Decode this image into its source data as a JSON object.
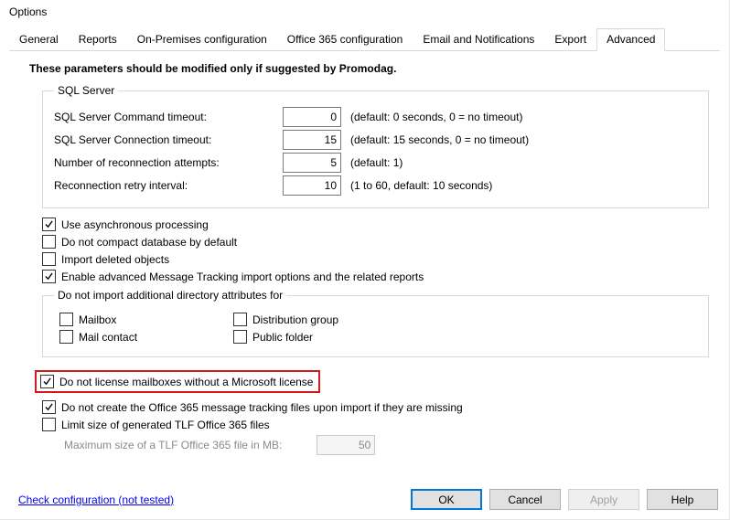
{
  "window_title": "Options",
  "tabs": {
    "general": "General",
    "reports": "Reports",
    "onprem": "On-Premises configuration",
    "o365": "Office 365 configuration",
    "email": "Email and Notifications",
    "export": "Export",
    "advanced": "Advanced"
  },
  "active_tab": "advanced",
  "heading": "These parameters should be modified only if suggested by Promodag.",
  "sql": {
    "legend": "SQL Server",
    "cmd_timeout": {
      "label": "SQL Server Command timeout:",
      "value": "0",
      "hint": "(default: 0 seconds, 0 = no timeout)"
    },
    "conn_timeout": {
      "label": "SQL Server Connection timeout:",
      "value": "15",
      "hint": "(default: 15 seconds, 0 = no timeout)"
    },
    "reconnect_attempts": {
      "label": "Number of reconnection attempts:",
      "value": "5",
      "hint": "(default: 1)"
    },
    "retry_interval": {
      "label": "Reconnection retry interval:",
      "value": "10",
      "hint": "(1 to 60, default: 10 seconds)"
    }
  },
  "opts": {
    "async": "Use asynchronous processing",
    "nocompact": "Do not compact database by default",
    "importdeleted": "Import deleted objects",
    "advtracking": "Enable advanced Message Tracking import options and the related reports"
  },
  "noimport": {
    "legend": "Do not import additional directory attributes for",
    "mailbox": "Mailbox",
    "mailcontact": "Mail contact",
    "distgroup": "Distribution group",
    "publicfolder": "Public folder"
  },
  "nolicense": "Do not license mailboxes without a Microsoft license",
  "nocreatefiles": "Do not create the Office 365 message tracking files upon import if they are missing",
  "limitsize": {
    "label": "Limit size of generated TLF Office 365 files",
    "sublabel": "Maximum size of a TLF Office 365 file in MB:",
    "value": "50"
  },
  "footer": {
    "checklink": "Check configuration (not tested)",
    "ok": "OK",
    "cancel": "Cancel",
    "apply": "Apply",
    "help": "Help"
  }
}
